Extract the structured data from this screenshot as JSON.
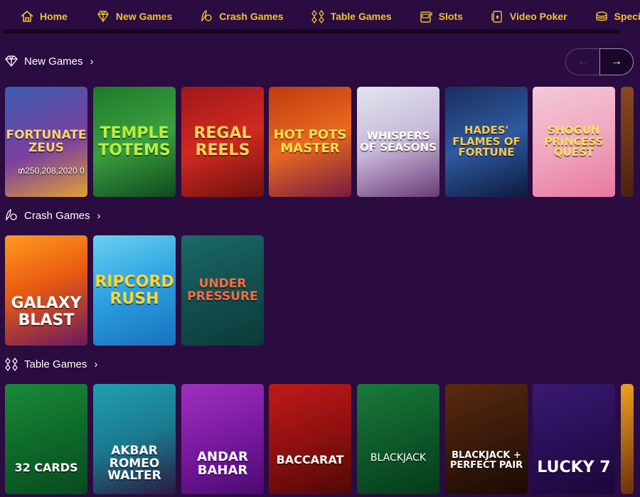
{
  "nav": [
    {
      "label": "Home",
      "icon": "house-icon"
    },
    {
      "label": "New Games",
      "icon": "diamond-icon"
    },
    {
      "label": "Crash Games",
      "icon": "rocket-coin-icon"
    },
    {
      "label": "Table Games",
      "icon": "card-suits-icon"
    },
    {
      "label": "Slots",
      "icon": "slot-machine-icon"
    },
    {
      "label": "Video Poker",
      "icon": "poker-card-icon"
    },
    {
      "label": "Specialty",
      "icon": "chips-icon"
    }
  ],
  "sections": {
    "new_games": {
      "title": "New Games",
      "tiles": [
        {
          "title": "FORTUNATE ZEUS",
          "overlay": "₥250,208,2020 0",
          "bg": "linear-gradient(160deg,#3a5db0,#7a3fa0 55%,#e0a030)",
          "color": "#f6d56a"
        },
        {
          "title": "TEMPLE TOTEMS",
          "bg": "linear-gradient(160deg,#1e7a2a,#3aa040 50%,#0e4a1c)",
          "color": "#b8f040"
        },
        {
          "title": "REGAL REELS",
          "bg": "linear-gradient(160deg,#a01818,#d02a20 50%,#701010)",
          "color": "#ffd45a"
        },
        {
          "title": "HOT POTS MASTER",
          "bg": "linear-gradient(160deg,#c03a10,#e86a20 50%,#7a1a40)",
          "color": "#ffe04a"
        },
        {
          "title": "WHISPERS OF SEASONS",
          "bg": "linear-gradient(160deg,#e0e6f0,#c8b8d8 50%,#6a3a78)",
          "color": "#ffffff"
        },
        {
          "title": "HADES' FLAMES OF FORTUNE",
          "bg": "linear-gradient(160deg,#1a2e60,#2e5aa0 50%,#0e1a40)",
          "color": "#f6c84a"
        },
        {
          "title": "SHOGUN PRINCESS QUEST",
          "bg": "linear-gradient(160deg,#f4c8d8,#f0a8c0 50%,#e878a0)",
          "color": "#ffe060"
        }
      ],
      "cut_bg": "linear-gradient(160deg,#8a4a20,#4a2010)"
    },
    "crash_games": {
      "title": "Crash Games",
      "tiles": [
        {
          "title": "GALAXY BLAST",
          "bg": "linear-gradient(160deg,#ff9a20,#e85a10 45%,#6a1a60)",
          "color": "#ffffff"
        },
        {
          "title": "RIPCORD RUSH",
          "bg": "linear-gradient(160deg,#6ad0f0,#2aa0e0 50%,#1a70c0)",
          "color": "#ffd630"
        },
        {
          "title": "UNDER PRESSURE",
          "bg": "linear-gradient(160deg,#1a6a6a,#12504e 50%,#0a3a3a)",
          "color": "#ff6a40"
        }
      ]
    },
    "table_games": {
      "title": "Table Games",
      "tiles": [
        {
          "title": "32 CARDS",
          "bg": "linear-gradient(160deg,#1a8a3a,#0e6a2a 50%,#0a4a1e)",
          "color": "#ffffff"
        },
        {
          "title": "AKBAR ROMEO WALTER",
          "bg": "linear-gradient(160deg,#20a0b0,#1a7a90 50%,#2a1a40)",
          "color": "#ffffff"
        },
        {
          "title": "ANDAR BAHAR",
          "bg": "linear-gradient(160deg,#a030c0,#7a1aa0 50%,#4a0a70)",
          "color": "#ffffff"
        },
        {
          "title": "BACCARAT",
          "bg": "linear-gradient(160deg,#c01a1a,#901010 50%,#500808)",
          "color": "#ffffff"
        },
        {
          "title": "BLACKJACK",
          "bg": "linear-gradient(160deg,#1a7a3a,#0e5a2a 50%,#063a1a)",
          "color": "#ffffff"
        },
        {
          "title": "BLACKJACK + PERFECT PAIR",
          "bg": "linear-gradient(160deg,#5a2a10,#3a1a0a 50%,#1a0a04)",
          "color": "#ffffff"
        },
        {
          "title": "LUCKY 7",
          "bg": "linear-gradient(160deg,#3a1a70,#2a0e58 50%,#1a0838)",
          "color": "#ffffff"
        }
      ],
      "cut_bg": "linear-gradient(160deg,#f0a020,#6a3010)"
    }
  },
  "pager": {
    "prev": "←",
    "next": "→"
  },
  "chevron": "›"
}
